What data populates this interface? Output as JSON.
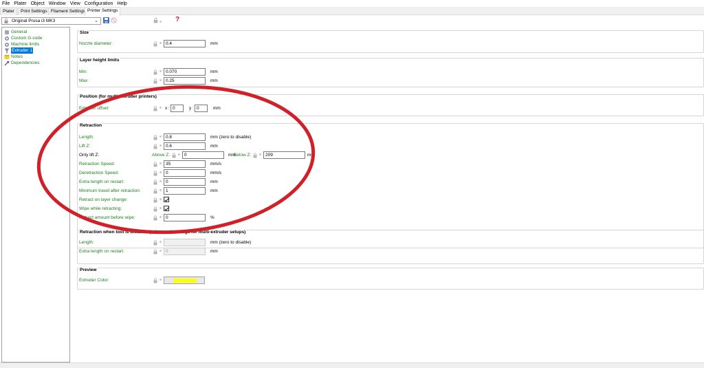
{
  "menu": [
    "File",
    "Plater",
    "Object",
    "Window",
    "View",
    "Configuration",
    "Help"
  ],
  "tabs": [
    "Plater",
    "Print Settings",
    "Filament Settings",
    "Printer Settings"
  ],
  "preset": {
    "name": "Original Prusa i3 MK3"
  },
  "help_mark": "?",
  "tree": [
    {
      "label": "General",
      "icon": "wrench-icon"
    },
    {
      "label": "Custom G-code",
      "icon": "cog-icon"
    },
    {
      "label": "Machine limits",
      "icon": "cog-icon"
    },
    {
      "label": "Extruder 1",
      "icon": "funnel-icon"
    },
    {
      "label": "Notes",
      "icon": "note-icon"
    },
    {
      "label": "Dependencies",
      "icon": "wrench-icon"
    }
  ],
  "size": {
    "title": "Size",
    "nozzle_label": "Nozzle diameter:",
    "nozzle_value": "0.4",
    "nozzle_unit": "mm"
  },
  "layer": {
    "title": "Layer height limits",
    "min_label": "Min:",
    "min_value": "0.070",
    "max_label": "Max:",
    "max_value": "0.25",
    "unit": "mm"
  },
  "position": {
    "title": "Position (for multi-extruder printers)",
    "offset_label": "Extruder offset:",
    "x_label": "x :",
    "x_value": "0",
    "y_label": "y :",
    "y_value": "0",
    "unit": "mm"
  },
  "retraction": {
    "title": "Retraction",
    "length_label": "Length:",
    "length_value": "0.8",
    "length_unit": "mm (zero to disable)",
    "lift_label": "Lift Z:",
    "lift_value": "0.6",
    "lift_unit": "mm",
    "only_lift_label": "Only lift Z:",
    "above_label": "Above Z:",
    "above_value": "0",
    "above_unit": "mm",
    "below_label": "Below Z:",
    "below_value": "209",
    "below_unit": "mm",
    "speed_label": "Retraction Speed:",
    "speed_value": "35",
    "speed_unit": "mm/s",
    "deretract_label": "Deretraction Speed:",
    "deretract_value": "0",
    "deretract_unit": "mm/s",
    "extra_label": "Extra length on restart:",
    "extra_value": "0",
    "extra_unit": "mm",
    "travel_label": "Minimum travel after retraction:",
    "travel_value": "1",
    "travel_unit": "mm",
    "layer_change_label": "Retract on layer change:",
    "wipe_label": "Wipe while retracting:",
    "before_wipe_label": "Retract amount before wipe:",
    "before_wipe_value": "0",
    "before_wipe_unit": "%"
  },
  "retraction_disabled": {
    "title": "Retraction when tool is disabled (advanced settings for multi-extruder setups)",
    "length_label": "Length:",
    "length_unit": "mm (zero to disable)",
    "extra_label": "Extra length on restart:",
    "extra_value": "0",
    "extra_unit": "mm"
  },
  "preview": {
    "title": "Preview",
    "color_label": "Extruder Color:",
    "color": "#ffff00"
  },
  "colors": {
    "annotation": "#d0202a",
    "label_green": "#1d7d1d",
    "selection": "#0078d7"
  }
}
